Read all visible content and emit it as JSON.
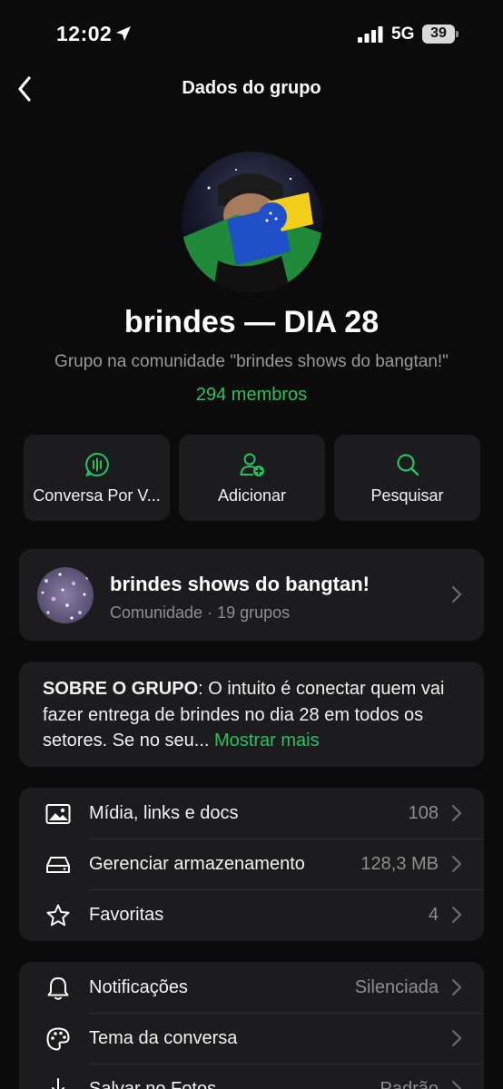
{
  "status_bar": {
    "time": "12:02",
    "network": "5G",
    "battery": "39"
  },
  "header": {
    "title": "Dados do grupo"
  },
  "group": {
    "name": "brindes — DIA 28",
    "community_line": "Grupo na comunidade \"brindes shows do bangtan!\"",
    "members": "294 membros"
  },
  "actions": [
    {
      "label": "Conversa Por V...",
      "icon": "voice-chat-icon"
    },
    {
      "label": "Adicionar",
      "icon": "add-person-icon"
    },
    {
      "label": "Pesquisar",
      "icon": "search-icon"
    }
  ],
  "community": {
    "name": "brindes shows do bangtan!",
    "subtitle": "Comunidade · 19 grupos"
  },
  "about": {
    "heading": "SOBRE O GRUPO",
    "text": ": O intuito é conectar quem vai fazer entrega de brindes no dia 28 em todos os setores. Se no seu... ",
    "show_more": "Mostrar mais"
  },
  "media_list": [
    {
      "label": "Mídia, links e docs",
      "value": "108",
      "icon": "image-icon"
    },
    {
      "label": "Gerenciar armazenamento",
      "value": "128,3 MB",
      "icon": "storage-icon"
    },
    {
      "label": "Favoritas",
      "value": "4",
      "icon": "star-icon"
    }
  ],
  "settings_list": [
    {
      "label": "Notificações",
      "value": "Silenciada",
      "icon": "bell-icon"
    },
    {
      "label": "Tema da conversa",
      "value": "",
      "icon": "palette-icon"
    },
    {
      "label": "Salvar no Fotos",
      "value": "Padrão",
      "icon": "save-photos-icon"
    }
  ],
  "colors": {
    "accent": "#25c25f",
    "card": "#1c1c1e",
    "background": "#0b0b0b",
    "secondary_text": "#8e8e8e"
  }
}
